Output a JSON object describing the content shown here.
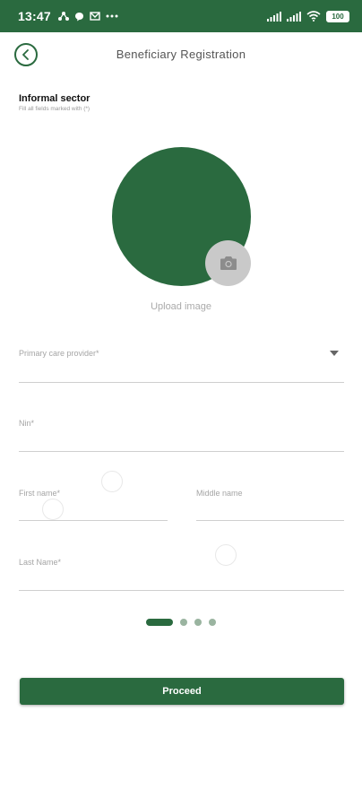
{
  "status_bar": {
    "time": "13:47",
    "left_icons": [
      "network-icon",
      "chat-icon",
      "mail-icon",
      "more-icon"
    ],
    "right_icons": [
      "signal-icon",
      "signal-icon",
      "wifi-icon"
    ],
    "battery": "100"
  },
  "header": {
    "title": "Beneficiary Registration",
    "back_icon": "chevron-left-icon"
  },
  "section": {
    "title": "Informal sector",
    "hint": "Fill all fields marked with (*)"
  },
  "photo": {
    "upload_label": "Upload image",
    "camera_icon": "camera-icon"
  },
  "form": {
    "primary_care_provider": "Primary care provider*",
    "nin": "Nin*",
    "first_name": "First name*",
    "middle_name": "Middle name",
    "last_name": "Last Name*"
  },
  "pager": {
    "total": 4,
    "active": 1
  },
  "actions": {
    "proceed": "Proceed"
  },
  "colors": {
    "primary": "#2a6a3f",
    "muted_dot": "#9ab4a0",
    "camera_bg": "#c9c9c9"
  }
}
